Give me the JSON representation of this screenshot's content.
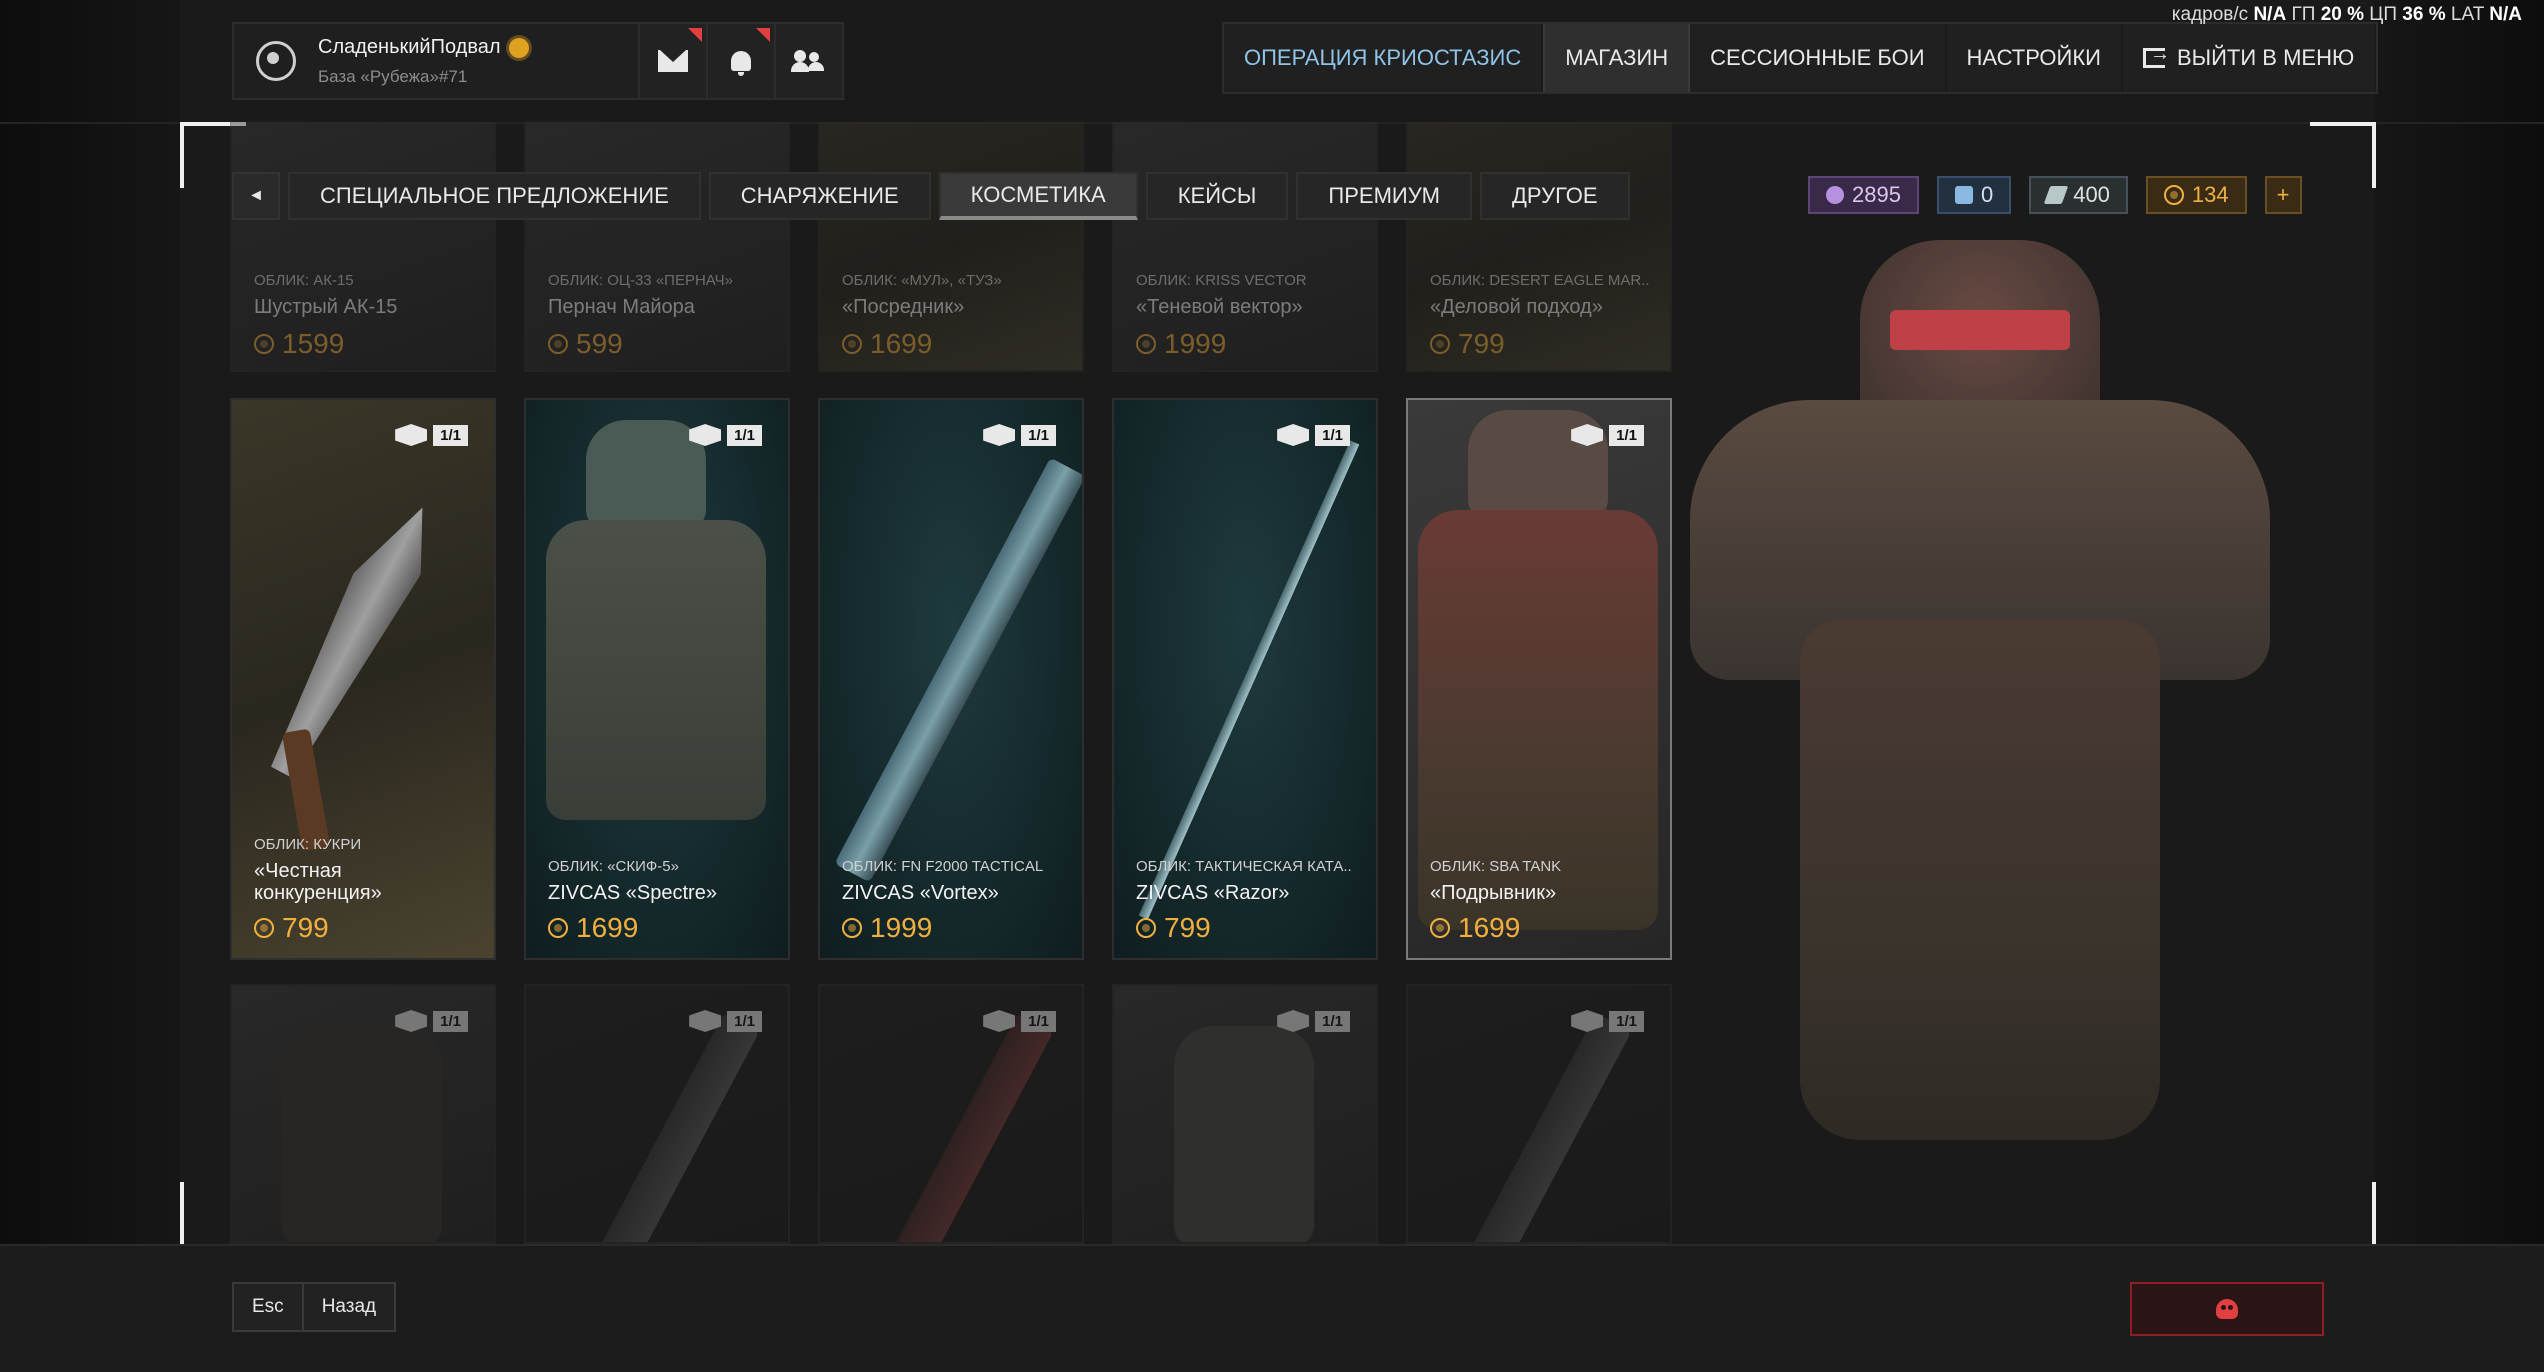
{
  "header": {
    "username": "СладенькийПодвал",
    "base": "База «Рубежа»#71"
  },
  "nav": {
    "items": [
      "ОПЕРАЦИЯ КРИОСТАЗИС",
      "МАГАЗИН",
      "СЕССИОННЫЕ БОИ",
      "НАСТРОЙКИ",
      "ВЫЙТИ В МЕНЮ"
    ],
    "active": "МАГАЗИН"
  },
  "stats": {
    "fps_label": "кадров/с",
    "fps": "N/A",
    "gpu_label": "ГП",
    "gpu": "20 %",
    "cpu_label": "ЦП",
    "cpu": "36 %",
    "lat_label": "LAT",
    "lat": "N/A"
  },
  "tabs": {
    "items": [
      "СПЕЦИАЛЬНОЕ ПРЕДЛОЖЕНИЕ",
      "СНАРЯЖЕНИЕ",
      "КОСМЕТИКА",
      "КЕЙСЫ",
      "ПРЕМИУМ",
      "ДРУГОЕ"
    ],
    "active": "КОСМЕТИКА"
  },
  "currencies": {
    "purple": "2895",
    "cyan": "0",
    "grey": "400",
    "gold": "134",
    "plus": "+"
  },
  "cards_top": [
    {
      "type": "ОБЛИК: АК-15",
      "name": "Шустрый АК-15",
      "price": "1599"
    },
    {
      "type": "ОБЛИК: ОЦ-33 «ПЕРНАЧ»",
      "name": "Пернач Майора",
      "price": "599"
    },
    {
      "type": "ОБЛИК: «МУЛ», «ТУЗ»",
      "name": "«Посредник»",
      "price": "1699"
    },
    {
      "type": "ОБЛИК: KRISS VECTOR",
      "name": "«Теневой вектор»",
      "price": "1999"
    },
    {
      "type": "ОБЛИК: DESERT EAGLE MAR..",
      "name": "«Деловой подход»",
      "price": "799"
    }
  ],
  "cards_mid": [
    {
      "type": "ОБЛИК: КУКРИ",
      "name": "«Честная конкуренция»",
      "price": "799",
      "badge": "1/1"
    },
    {
      "type": "ОБЛИК: «СКИФ-5»",
      "name": "ZIVCAS «Spectre»",
      "price": "1699",
      "badge": "1/1"
    },
    {
      "type": "ОБЛИК: FN F2000 TACTICAL",
      "name": "ZIVCAS «Vortex»",
      "price": "1999",
      "badge": "1/1"
    },
    {
      "type": "ОБЛИК: ТАКТИЧЕСКАЯ КАТА..",
      "name": "ZIVCAS «Razor»",
      "price": "799",
      "badge": "1/1"
    },
    {
      "type": "ОБЛИК: SBA TANK",
      "name": "«Подрывник»",
      "price": "1699",
      "badge": "1/1"
    }
  ],
  "cards_bottom_badges": [
    "1/1",
    "1/1",
    "1/1",
    "1/1",
    "1/1"
  ],
  "bottom": {
    "esc": "Esc",
    "back": "Назад"
  },
  "colors": {
    "accent_gold": "#f0b040",
    "nav_highlight": "#8fc3e8",
    "danger": "#e04040"
  }
}
